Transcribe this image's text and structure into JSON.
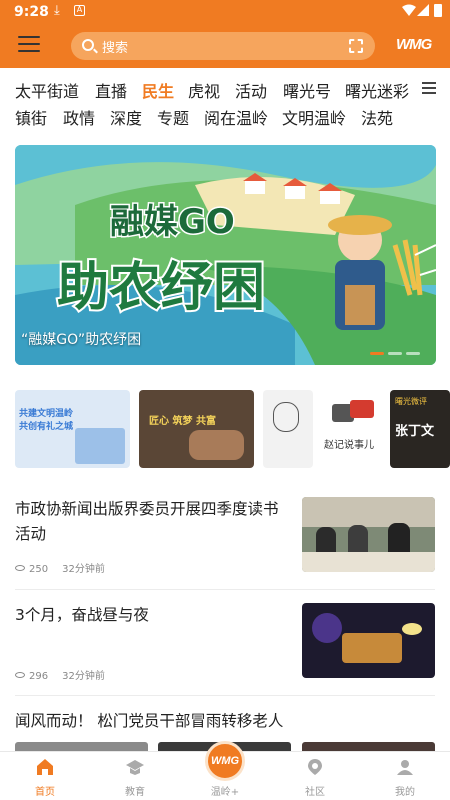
{
  "status": {
    "time": "9:28"
  },
  "header": {
    "search_placeholder": "搜索",
    "logo_text": "WMG"
  },
  "channels": {
    "row1": [
      "太平街道",
      "直播",
      "民生",
      "虎视",
      "活动",
      "曙光号",
      "曙光迷彩"
    ],
    "row2": [
      "镇街",
      "政情",
      "深度",
      "专题",
      "阅在温岭",
      "文明温岭",
      "法苑"
    ],
    "active": "民生"
  },
  "banner": {
    "caption": "“融媒GO”助农纾困",
    "art_line1": "融媒GO",
    "art_line2": "助农纾困"
  },
  "topics": [
    {
      "line1": "共建文明温岭",
      "line2": "共创有礼之城"
    },
    {
      "text": "匠心 筑梦 共富"
    },
    {
      "text": ""
    },
    {
      "text": "赵记说事儿"
    },
    {
      "line1": "曙光微评",
      "line2": "张丁文"
    }
  ],
  "news": [
    {
      "title": "市政协新闻出版界委员开展四季度读书活动",
      "views": "250",
      "time": "32分钟前"
    },
    {
      "title": "3个月，奋战昼与夜",
      "views": "296",
      "time": "32分钟前"
    },
    {
      "title": "闻风而动！ 松门党员干部冒雨转移老人"
    }
  ],
  "bottom_nav": [
    {
      "label": "首页",
      "icon": "home-icon"
    },
    {
      "label": "教育",
      "icon": "graduation-cap-icon"
    },
    {
      "label": "温岭+",
      "icon": "wmg-logo-icon"
    },
    {
      "label": "社区",
      "icon": "map-pin-icon"
    },
    {
      "label": "我的",
      "icon": "user-icon"
    }
  ],
  "colors": {
    "accent": "#f07b22",
    "text": "#222222",
    "meta": "#888888"
  }
}
